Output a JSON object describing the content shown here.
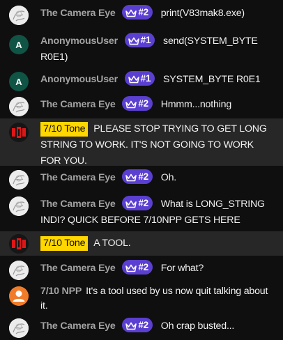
{
  "messages": [
    {
      "author": "The Camera Eye",
      "badge": "#2",
      "text": "print(V83mak8.exe)"
    },
    {
      "author": "AnonymousUser",
      "avatar_letter": "A",
      "badge": "#1",
      "text": "send(SYSTEM_BYTE R0E1)"
    },
    {
      "author": "AnonymousUser",
      "avatar_letter": "A",
      "badge": "#1",
      "text": "SYSTEM_BYTE R0E1"
    },
    {
      "author": "The Camera Eye",
      "badge": "#2",
      "text": "Hmmm...nothing"
    },
    {
      "author": "7/10 Tone",
      "text": "PLEASE STOP TRYING TO GET LONG STRING TO WORK. IT'S NOT GOING TO WORK FOR YOU."
    },
    {
      "author": "The Camera Eye",
      "badge": "#2",
      "text": "Oh."
    },
    {
      "author": "The Camera Eye",
      "badge": "#2",
      "text": "What is LONG_STRING INDI? QUICK BEFORE 7/10NPP GETS HERE"
    },
    {
      "author": "7/10 Tone",
      "text": "A TOOL."
    },
    {
      "author": "The Camera Eye",
      "badge": "#2",
      "text": "For what?"
    },
    {
      "author": "7/10 NPP",
      "text": "It's a tool used by us now quit talking about it."
    },
    {
      "author": "The Camera Eye",
      "badge": "#2",
      "text": "Oh crap busted..."
    }
  ],
  "colors": {
    "background": "#0f0f0f",
    "highlight_row": "#272727",
    "member_badge": "#5b3fd0",
    "owner_chip": "#ffd600",
    "author_text": "#a3a3a3",
    "npp_avatar": "#f07c2a",
    "anon_avatar": "#0f5445"
  },
  "icons": {
    "badge": "crown-icon",
    "camera_eye_avatar": "sketch-avatar-icon",
    "tone_avatar": "red-logo-icon",
    "npp_avatar": "person-icon"
  }
}
